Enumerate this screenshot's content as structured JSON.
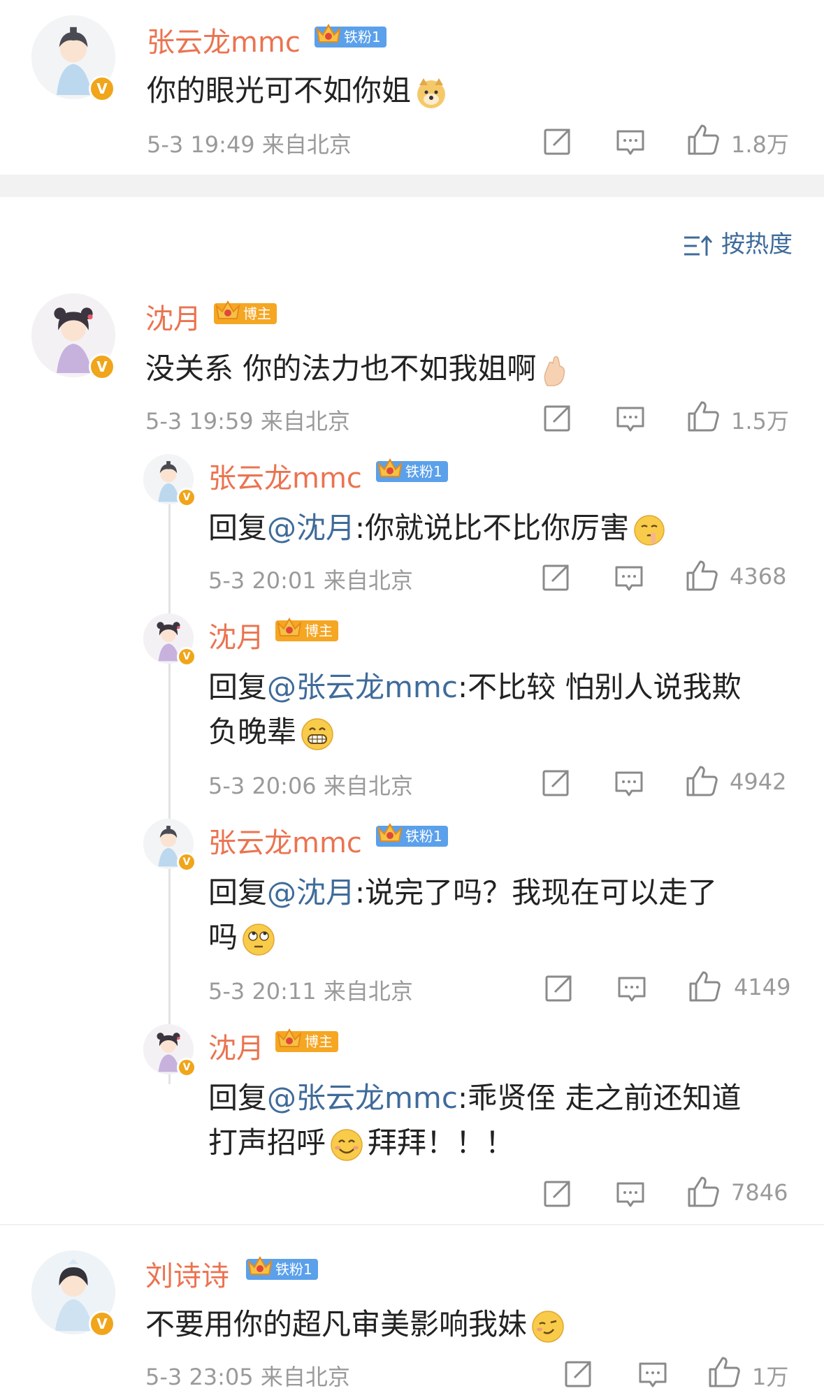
{
  "top_comment": {
    "author": "张云龙mmc",
    "badge": "铁粉1",
    "text": "你的眼光可不如你姐",
    "time": "5-3 19:49",
    "location": "来自北京",
    "likes": "1.8万"
  },
  "sort_label": "按热度",
  "comments": [
    {
      "author": "沈月",
      "badge": "博主",
      "text": "没关系 你的法力也不如我姐啊",
      "time": "5-3 19:59",
      "location": "来自北京",
      "likes": "1.5万"
    },
    {
      "author": "张云龙mmc",
      "badge": "铁粉1",
      "reply_prefix": "回复",
      "mention": "@沈月",
      "text": ":你就说比不比你厉害",
      "time": "5-3 20:01",
      "location": "来自北京",
      "likes": "4368"
    },
    {
      "author": "沈月",
      "badge": "博主",
      "reply_prefix": "回复",
      "mention": "@张云龙mmc",
      "text_line1": ":不比较 怕别人说我欺",
      "text_line2": "负晚辈",
      "time": "5-3 20:06",
      "location": "来自北京",
      "likes": "4942"
    },
    {
      "author": "张云龙mmc",
      "badge": "铁粉1",
      "reply_prefix": "回复",
      "mention": "@沈月",
      "text_line1": ":说完了吗？我现在可以走了",
      "text_line2": "吗",
      "time": "5-3 20:11",
      "location": "来自北京",
      "likes": "4149"
    },
    {
      "author": "沈月",
      "badge": "博主",
      "reply_prefix": "回复",
      "mention": "@张云龙mmc",
      "text_line1": ":乖贤侄 走之前还知道",
      "text_line2a": "打声招呼",
      "text_line2b": "拜拜！！！",
      "likes": "7846"
    },
    {
      "author": "刘诗诗",
      "badge": "铁粉1",
      "text": "不要用你的超凡审美影响我妹",
      "time": "5-3 23:05",
      "location": "来自北京",
      "likes": "1万"
    }
  ],
  "icons": {
    "share": "share-icon",
    "comment": "comment-icon",
    "like": "like-icon",
    "verified": "verified-v-badge",
    "sort": "sort-icon"
  },
  "verified_mark": "V",
  "colors": {
    "name": "#eb7350",
    "mention": "#3f6b9a",
    "meta": "#9a9a9a",
    "fan_tag": "#5ba0ea",
    "host_tag": "#f5a623",
    "verified": "#f0a51a"
  }
}
